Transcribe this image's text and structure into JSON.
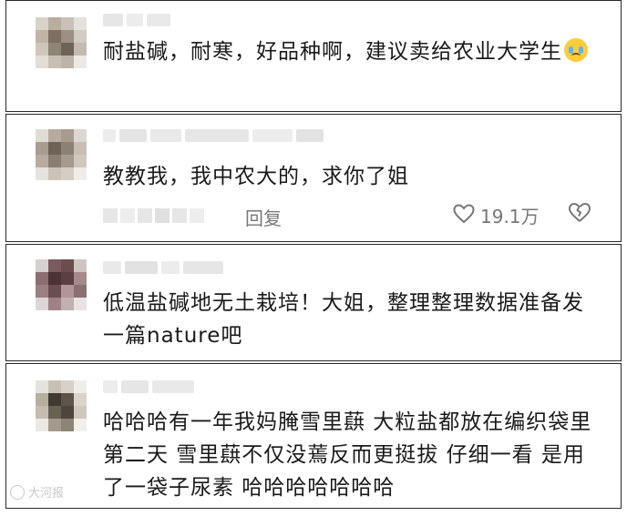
{
  "comments": [
    {
      "text": "耐盐碱，耐寒，好品种啊，建议卖给农业大学生",
      "emoji": "crying-face-emoji"
    },
    {
      "text": "教教我，我中农大的，求你了姐",
      "reply_label": "回复",
      "like_count": "19.1万"
    },
    {
      "text": "低温盐碱地无土栽培！大姐，整理整理数据准备发一篇nature吧"
    },
    {
      "text": "哈哈哈有一年我妈腌雪里蕻 大粒盐都放在编织袋里 第二天 雪里蕻不仅没蔫反而更挺拔 仔细一看 是用了一袋子尿素 哈哈哈哈哈哈哈"
    }
  ],
  "watermark": "大河报",
  "colors": {
    "border": "#2a2a2a",
    "meta": "#777777"
  }
}
